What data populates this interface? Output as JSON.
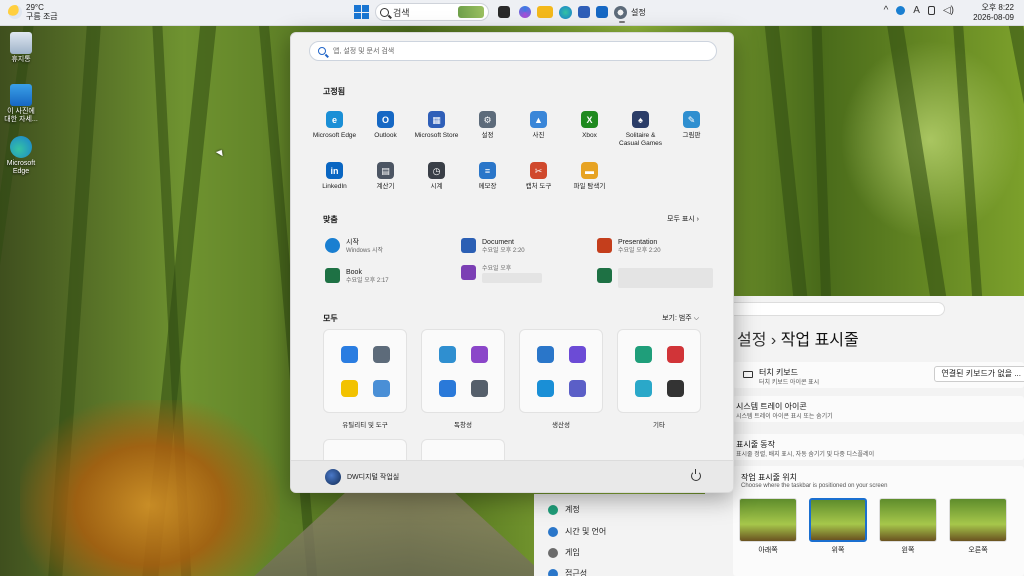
{
  "taskbar": {
    "weather_temp": "29°C",
    "weather_desc": "구름 조금",
    "search_label": "검색",
    "settings_label": "설정",
    "clock_time": "오후 8:22",
    "clock_date": "2026-08-09",
    "ime": "A"
  },
  "desktop": {
    "icons": [
      {
        "label": "휴지통",
        "icon": "recycle-bin-icon"
      },
      {
        "label": "이 사진에 대한 자세...",
        "icon": "photo-info-icon"
      },
      {
        "label": "Microsoft Edge",
        "icon": "edge-icon"
      }
    ]
  },
  "start": {
    "search_placeholder": "앱, 설정 및 문서 검색",
    "pinned_title": "고정됨",
    "pinned": [
      {
        "label": "Microsoft Edge",
        "color": "#1a8fd6",
        "glyph": "e"
      },
      {
        "label": "Outlook",
        "color": "#1668c4",
        "glyph": "O"
      },
      {
        "label": "Microsoft Store",
        "color": "#2f5fb8",
        "glyph": "▦"
      },
      {
        "label": "설정",
        "color": "#5d6b7a",
        "glyph": "⚙"
      },
      {
        "label": "사진",
        "color": "#3a86d8",
        "glyph": "▲"
      },
      {
        "label": "Xbox",
        "color": "#1f8a1f",
        "glyph": "X"
      },
      {
        "label": "Solitaire & Casual Games",
        "color": "#2b3d68",
        "glyph": "♠"
      },
      {
        "label": "그림판",
        "color": "#2f8fd0",
        "glyph": "✎"
      },
      {
        "label": "LinkedIn",
        "color": "#0a66c2",
        "glyph": "in"
      },
      {
        "label": "계산기",
        "color": "#4c5563",
        "glyph": "▤"
      },
      {
        "label": "시계",
        "color": "#3a3f47",
        "glyph": "◷"
      },
      {
        "label": "메모장",
        "color": "#2a76c9",
        "glyph": "≡"
      },
      {
        "label": "캡처 도구",
        "color": "#d0492d",
        "glyph": "✂"
      },
      {
        "label": "파일 탐색기",
        "color": "#e7a323",
        "glyph": "▬"
      }
    ],
    "recommended_title": "맞춤",
    "show_all": "모두 표시  ›",
    "recommended": [
      {
        "name": "시작",
        "sub": "Windows 시작",
        "color": "#1a7fd1"
      },
      {
        "name": "Document",
        "sub": "수요일 오후 2:20",
        "color": "#2b5fb4"
      },
      {
        "name": "Presentation",
        "sub": "수요일 오후 2:20",
        "color": "#c43e1c"
      },
      {
        "name": "Book",
        "sub": "수요일 오후 2:17",
        "color": "#1e7144"
      },
      {
        "name": "",
        "sub": "수요일 오후",
        "color": "#7b3fb4"
      },
      {
        "name": "",
        "sub": "",
        "color": "#1e7144"
      }
    ],
    "all_title": "모두",
    "view_label": "보기: 범주  ⌵",
    "folders": [
      {
        "label": "유틸리티 및 도구",
        "icons": [
          "#2a7de1",
          "#5d6b7a",
          "#f2c200",
          "#4a8fd6"
        ]
      },
      {
        "label": "독창성",
        "icons": [
          "#2f8fd0",
          "#8b46c9",
          "#2a79d9",
          "#555f6b"
        ]
      },
      {
        "label": "생산성",
        "icons": [
          "#2a76c9",
          "#6c4bd6",
          "#1a8fd6",
          "#5b5fc7"
        ]
      },
      {
        "label": "기타",
        "icons": [
          "#1f9e7a",
          "#d13438",
          "#2aa8c9",
          "#333333"
        ]
      }
    ],
    "user_name": "DW디지털 작업실"
  },
  "settings": {
    "breadcrumb_parent": "l 설정",
    "breadcrumb_sep": "›",
    "breadcrumb_current": "작업 표시줄",
    "touch_kbd_title": "터치 키보드",
    "touch_kbd_sub": "터치 키보드 아이콘 표시",
    "touch_kbd_value": "연결된 키보드가 없을 ...",
    "tray_title": "시스템 트레이 아이콘",
    "tray_sub": "시스템 트레이 아이콘 표시 또는 숨기기",
    "behav_title": "표시줄 동작",
    "behav_sub": "표시줄 정렬, 배지 표시, 자동 숨기기 및 다중 디스플레이",
    "pos_title": "작업 표시줄 위치",
    "pos_sub": "Choose where the taskbar is positioned on your screen",
    "positions": [
      "아래쪽",
      "위쪽",
      "왼쪽",
      "오른쪽"
    ],
    "nav": [
      {
        "label": "계정",
        "color": "#1f9e7a"
      },
      {
        "label": "시간 및 언어",
        "color": "#2a76c9"
      },
      {
        "label": "게임",
        "color": "#6b6b6b"
      },
      {
        "label": "접근성",
        "color": "#2a76c9"
      }
    ]
  }
}
